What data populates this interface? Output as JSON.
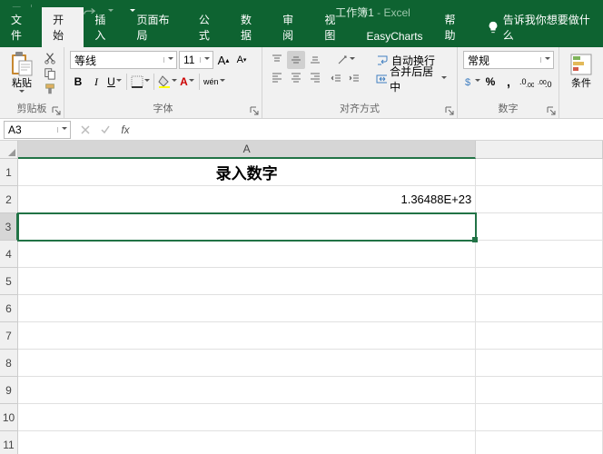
{
  "title": {
    "doc": "工作簿1",
    "sep": " - ",
    "app": "Excel"
  },
  "tabs": {
    "file": "文件",
    "home": "开始",
    "insert": "插入",
    "pagelayout": "页面布局",
    "formulas": "公式",
    "data": "数据",
    "review": "审阅",
    "view": "视图",
    "easycharts": "EasyCharts",
    "help": "帮助",
    "tellme": "告诉我你想要做什么"
  },
  "ribbon": {
    "clipboard": {
      "paste": "粘贴",
      "label": "剪贴板"
    },
    "font": {
      "family": "等线",
      "size": "11",
      "label": "字体",
      "wen": "wén"
    },
    "alignment": {
      "wrap": "自动换行",
      "merge": "合并后居中",
      "label": "对齐方式"
    },
    "number": {
      "format": "常规",
      "label": "数字"
    },
    "styles": {
      "cond": "条件"
    }
  },
  "fxbar": {
    "name": "A3",
    "fx": "fx"
  },
  "grid": {
    "colA_w": 505,
    "colB_w": 140,
    "cols": [
      "A"
    ],
    "rows": [
      "1",
      "2",
      "3",
      "4",
      "5",
      "6",
      "7",
      "8",
      "9",
      "10",
      "11"
    ],
    "a1": "录入数字",
    "a2": "1.36488E+23",
    "sel_row": 2
  }
}
